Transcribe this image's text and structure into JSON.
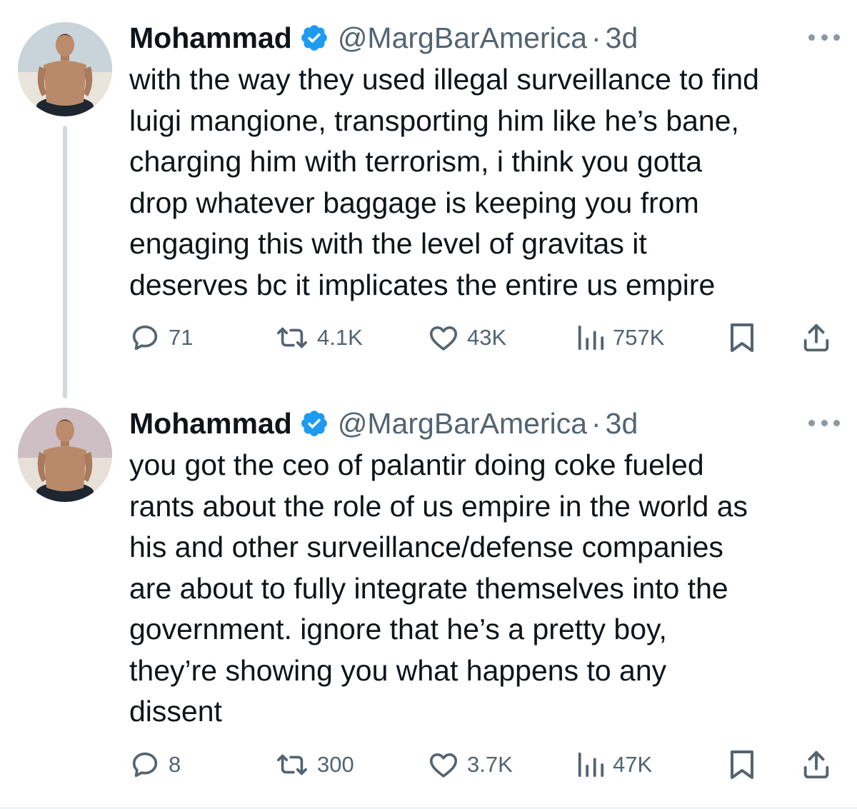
{
  "colors": {
    "text": "#0f1419",
    "secondary": "#536471",
    "verified": "#1d9bf0",
    "thread_line": "#cfd9de"
  },
  "tweets": [
    {
      "display_name": "Mohammad",
      "handle": "@MargBarAmerica",
      "separator": "·",
      "time": "3d",
      "body_lines": [
        "with the way they used illegal surveillance to find",
        "luigi mangione, transporting him like he’s bane,",
        "charging him with terrorism, i think you gotta",
        "drop whatever baggage is keeping you from",
        "engaging this with the level of gravitas it",
        "deserves bc it implicates the entire us empire"
      ],
      "replies": "71",
      "reposts": "4.1K",
      "likes": "43K",
      "views": "757K"
    },
    {
      "display_name": "Mohammad",
      "handle": "@MargBarAmerica",
      "separator": "·",
      "time": "3d",
      "body_lines": [
        "you got the ceo of palantir doing coke fueled",
        "rants about the role of us empire in the world as",
        "his and other surveillance/defense companies",
        "are about to fully integrate themselves into the",
        "government. ignore that he’s a pretty boy,",
        "they’re showing you what happens to any",
        "dissent"
      ],
      "replies": "8",
      "reposts": "300",
      "likes": "3.7K",
      "views": "47K"
    }
  ],
  "icons": {
    "verified": "verified-badge-icon",
    "more": "more-options-icon",
    "reply": "reply-icon",
    "repost": "repost-icon",
    "like": "heart-icon",
    "views": "views-bar-chart-icon",
    "bookmark": "bookmark-icon",
    "share": "share-icon"
  }
}
